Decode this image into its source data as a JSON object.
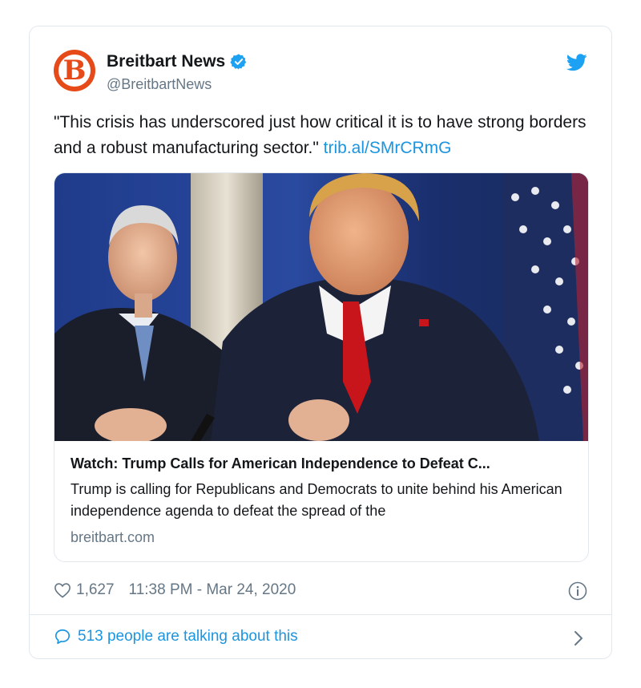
{
  "account": {
    "display_name": "Breitbart News",
    "handle": "@BreitbartNews",
    "avatar_letter": "B",
    "verified": true,
    "brand_color": "#e64a19"
  },
  "tweet": {
    "text": "\"This crisis has underscored just how critical it is to have strong borders and a robust manufacturing sector.\"",
    "link": "trib.al/SMrCRmG"
  },
  "card": {
    "title": "Watch: Trump Calls for American Independence to Defeat C...",
    "description": "Trump is calling for Republicans and Democrats to unite behind his American independence agenda to defeat the spread of the",
    "domain": "breitbart.com"
  },
  "meta": {
    "likes": "1,627",
    "timestamp": "11:38 PM - Mar 24, 2020"
  },
  "footer": {
    "talking": "513 people are talking about this"
  },
  "colors": {
    "link": "#1b95e0",
    "secondary_text": "#657786",
    "border": "#e1e8ed"
  },
  "icons": [
    "verified-badge-icon",
    "twitter-bird-icon",
    "heart-icon",
    "info-icon",
    "comment-bubble-icon",
    "chevron-right-icon"
  ]
}
